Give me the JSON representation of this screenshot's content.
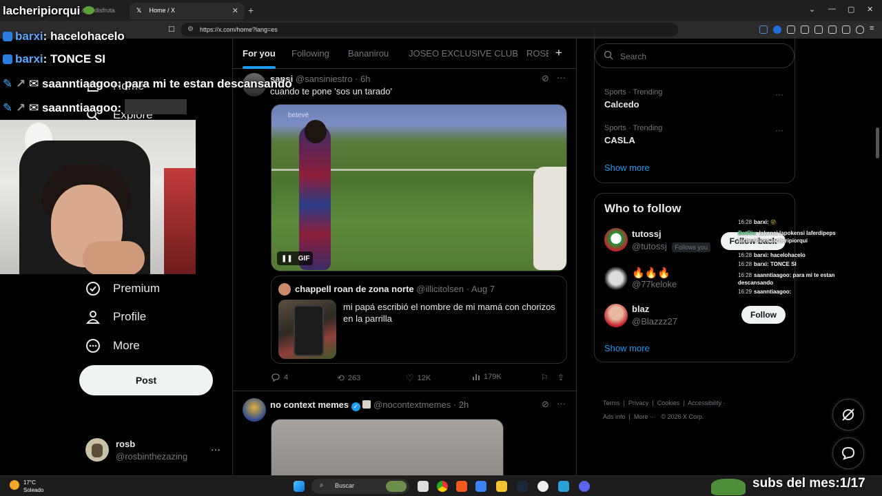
{
  "browser": {
    "tabs": [
      {
        "label": "…ón r disfruta",
        "active": false
      },
      {
        "label": "Home / X",
        "active": true
      }
    ],
    "url": "https://x.com/home?lang=es"
  },
  "nav": {
    "items": [
      {
        "label": "Home",
        "icon": "home-icon"
      },
      {
        "label": "Explore",
        "icon": "search-icon"
      },
      {
        "label": "Premium",
        "icon": "verified-badge-icon"
      },
      {
        "label": "Profile",
        "icon": "person-icon"
      },
      {
        "label": "More",
        "icon": "more-circle-icon"
      }
    ],
    "post_label": "Post",
    "account": {
      "name": "rosb",
      "handle": "@rosbinthezazing"
    }
  },
  "feed": {
    "tabs": [
      "For you",
      "Following",
      "Bananirou",
      "JOSEO EXCLUSIVE CLUB",
      "ROSB"
    ],
    "active_tab": "For you",
    "tweet1": {
      "name": "sansi",
      "handle": "@sansiniestro",
      "time": "6h",
      "text": "cuando te pone 'sos un tarado'",
      "media_watermark": "betevé",
      "media_badge": "GIF",
      "quote": {
        "name": "chappell roan de zona norte",
        "handle": "@illicitolsen",
        "date": "Aug 7",
        "text": "mi papá escribió el nombre de mi mamá con chorizos en la parrilla"
      },
      "stats": {
        "replies": "4",
        "reposts": "263",
        "likes": "12K",
        "views": "179K"
      }
    },
    "tweet2": {
      "name": "no context memes",
      "handle": "@nocontextmemes",
      "time": "2h"
    }
  },
  "sidebar": {
    "search_placeholder": "Search",
    "trends": [
      {
        "meta": "Sports · Trending",
        "name": "Calcedo"
      },
      {
        "meta": "Sports · Trending",
        "name": "CASLA"
      }
    ],
    "trends_show_more": "Show more",
    "who_to_follow": {
      "title": "Who to follow",
      "accounts": [
        {
          "name": "tutossj",
          "handle": "@tutossj",
          "badge": "Follows you",
          "button": "Follow back"
        },
        {
          "name": "🔥🔥🔥",
          "handle": "@77keloke",
          "badge": "",
          "button": ""
        },
        {
          "name": "blaz",
          "handle": "@Blazzz27",
          "badge": "",
          "button": "Follow"
        }
      ],
      "show_more": "Show more"
    },
    "footer": {
      "line1": [
        "Terms",
        "Privacy",
        "Cookies",
        "Accessibility"
      ],
      "line2": [
        "Ads info",
        "More ···",
        "© 2026 X Corp."
      ]
    }
  },
  "overlay": {
    "title": "lacheripiorqui",
    "chat": [
      {
        "user": "barxi",
        "text": "hacelohacelo"
      },
      {
        "user": "barxi",
        "text": "TONCE SI"
      },
      {
        "user": "saanntiaagoo",
        "text": "para mi te estan descansando"
      },
      {
        "user": "saanntiaagoo",
        "text": ""
      }
    ],
    "mini_chat": [
      {
        "time": "16:28",
        "user": "barxi",
        "text": ""
      },
      {
        "time": "",
        "user": "BotRix",
        "text": "lakensi lapokensi laferdipeps lacheridioro lacheripiorqui"
      },
      {
        "time": "16:28",
        "user": "barxi",
        "text": "hacelohacelo"
      },
      {
        "time": "16:28",
        "user": "barxi",
        "text": "TONCE SI"
      },
      {
        "time": "16:28",
        "user": "saanntiaagoo",
        "text": "para mi te estan descansando"
      },
      {
        "time": "16:29",
        "user": "saanntiaagoo",
        "text": ""
      }
    ],
    "subs": "subs del mes:1/17"
  },
  "taskbar": {
    "weather_temp": "17°C",
    "weather_desc": "Soleado",
    "search_label": "Buscar"
  }
}
